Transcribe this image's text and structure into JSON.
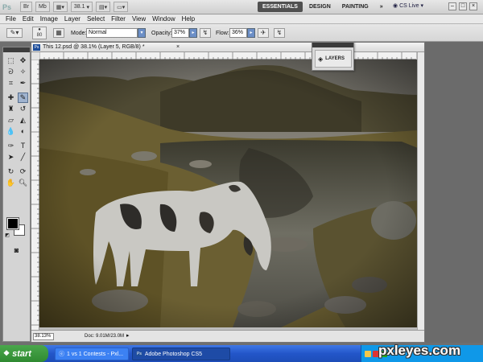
{
  "appbar": {
    "logo": "Ps",
    "zoom_value": "38.1",
    "workspaces": [
      "ESSENTIALS",
      "DESIGN",
      "PAINTING"
    ],
    "more": "»",
    "cs_live": "CS Live"
  },
  "menus": [
    "File",
    "Edit",
    "Image",
    "Layer",
    "Select",
    "Filter",
    "View",
    "Window",
    "Help"
  ],
  "options": {
    "brush_size": "80",
    "mode_label": "Mode:",
    "mode_value": "Normal",
    "opacity_label": "Opacity:",
    "opacity_value": "37%",
    "flow_label": "Flow:",
    "flow_value": "36%"
  },
  "document": {
    "title": "This 12.psd @ 38.1% (Layer 5, RGB/8) *",
    "zoom": "38.13%",
    "doc_info": "Doc: 9.01M/23.0M"
  },
  "layers_panel": {
    "label": "LAYERS"
  },
  "taskbar": {
    "start": "start",
    "tasks": [
      "1 vs 1 Contests - Pxl...",
      "Adobe Photoshop CS5"
    ],
    "tray_time": "",
    "watermark": "pxleyes.com"
  }
}
